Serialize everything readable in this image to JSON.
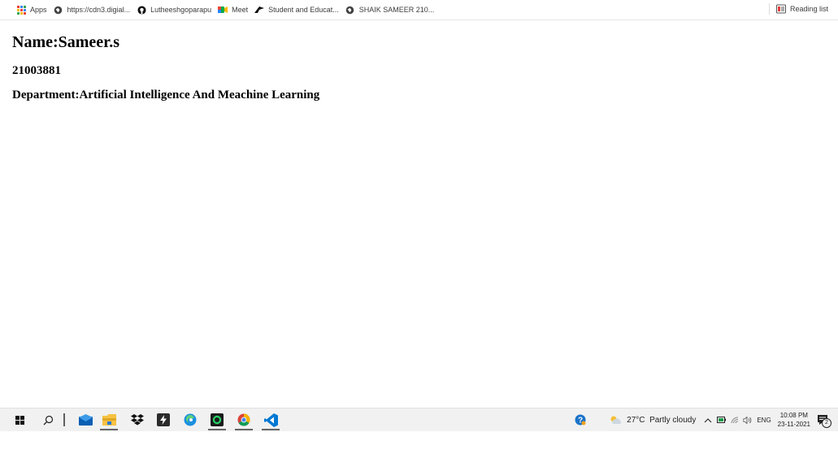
{
  "bookmarks": {
    "items": [
      {
        "label": "Apps",
        "icon": "apps-grid-icon"
      },
      {
        "label": "https://cdn3.digial...",
        "icon": "globe-icon"
      },
      {
        "label": "Lutheeshgoparapu",
        "icon": "github-icon"
      },
      {
        "label": "Meet",
        "icon": "meet-icon"
      },
      {
        "label": "Student and Educat...",
        "icon": "student-icon"
      },
      {
        "label": "SHAIK SAMEER 210...",
        "icon": "globe-icon"
      }
    ],
    "reading_list": "Reading list"
  },
  "page": {
    "name": "Name:Sameer.s",
    "id": "21003881",
    "department": "Department:Artificial Intelligence And Meachine Learning"
  },
  "taskbar": {
    "weather": "27°C  Partly cloudy",
    "language": "ENG",
    "time": "10:08 PM",
    "date": "23-11-2021",
    "notifications": "2"
  }
}
